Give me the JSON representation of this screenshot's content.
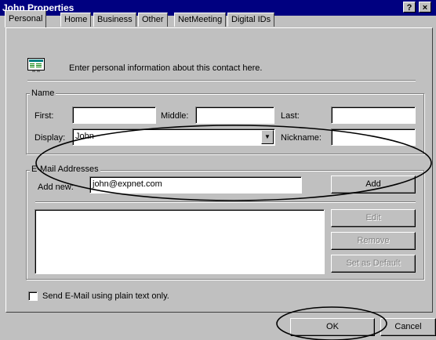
{
  "window": {
    "title": "John Properties",
    "help_label": "?",
    "close_label": "×"
  },
  "tabs": [
    {
      "label": "Personal",
      "active": true
    },
    {
      "label": "Home"
    },
    {
      "label": "Business"
    },
    {
      "label": "Other"
    },
    {
      "label": "NetMeeting"
    },
    {
      "label": "Digital IDs"
    }
  ],
  "intro": {
    "text": "Enter personal information about this contact here.",
    "icon": "contact-card-icon"
  },
  "name_group": {
    "label": "Name",
    "first_label": "First:",
    "middle_label": "Middle:",
    "last_label": "Last:",
    "first_value": "",
    "middle_value": "",
    "last_value": "",
    "display_label": "Display:",
    "display_value": "John",
    "nickname_label": "Nickname:",
    "nickname_value": ""
  },
  "email_group": {
    "label": "E-Mail Addresses",
    "add_new_label": "Add new:",
    "add_new_value": "john@expnet.com",
    "add_button": "Add",
    "edit_button": "Edit",
    "remove_button": "Remove",
    "default_button": "Set as Default"
  },
  "plain_text_checkbox": {
    "label": "Send E-Mail using plain text only.",
    "checked": false
  },
  "footer": {
    "ok_button": "OK",
    "cancel_button": "Cancel"
  },
  "colors": {
    "titlebar": "#000080",
    "face": "#c0c0c0",
    "annotation_stroke": "#000000"
  }
}
